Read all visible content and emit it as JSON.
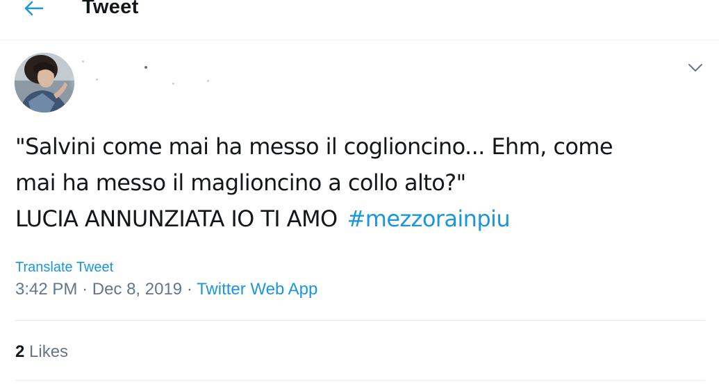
{
  "header": {
    "title": "Tweet",
    "back_icon": "arrow-left-icon",
    "accent_color": "#1b95e0"
  },
  "tweet": {
    "avatar_icon": "profile-photo",
    "menu_icon": "chevron-down-icon",
    "text_lines": [
      "\"Salvini come mai ha messo il coglioncino... Ehm, come",
      "mai ha messo il maglioncino a collo alto?\"",
      "LUCIA ANNUNZIATA IO TI AMO"
    ],
    "hashtag": "#mezzorainpiu",
    "translate_label": "Translate Tweet",
    "time": "3:42 PM",
    "date": "Dec 8, 2019",
    "separator": "·",
    "source": "Twitter Web App",
    "likes_count": "2",
    "likes_label": "Likes"
  }
}
